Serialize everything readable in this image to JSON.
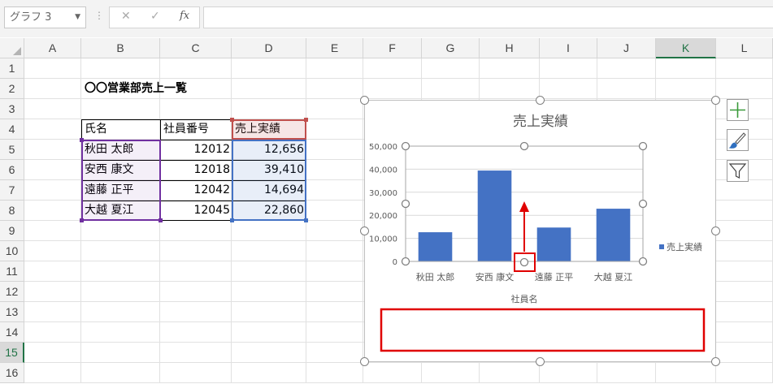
{
  "formula_bar": {
    "name_box": "グラフ 3",
    "cancel_glyph": "✕",
    "enter_glyph": "✓",
    "fx_glyph": "fx",
    "formula_value": ""
  },
  "columns": [
    "A",
    "B",
    "C",
    "D",
    "E",
    "F",
    "G",
    "H",
    "I",
    "J",
    "K",
    "L"
  ],
  "rows": [
    "1",
    "2",
    "3",
    "4",
    "5",
    "6",
    "7",
    "8",
    "9",
    "10",
    "11",
    "12",
    "13",
    "14",
    "15",
    "16"
  ],
  "sheet": {
    "title": "〇〇営業部売上一覧",
    "headers": [
      "氏名",
      "社員番号",
      "売上実績"
    ],
    "data": [
      [
        "秋田 太郎",
        "12012",
        "12,656"
      ],
      [
        "安西 康文",
        "12018",
        "39,410"
      ],
      [
        "遠藤 正平",
        "12042",
        "14,694"
      ],
      [
        "大越 夏江",
        "12045",
        "22,860"
      ]
    ]
  },
  "chart_data": {
    "type": "bar",
    "title": "売上実績",
    "xlabel": "社員名",
    "ylabel": "",
    "categories": [
      "秋田 太郎",
      "安西 康文",
      "遠藤 正平",
      "大越 夏江"
    ],
    "series": [
      {
        "name": "売上実績",
        "values": [
          12656,
          39410,
          14694,
          22860
        ],
        "color": "#4472c4"
      }
    ],
    "ylim": [
      0,
      50000
    ],
    "yticks": [
      "0",
      "10,000",
      "20,000",
      "30,000",
      "40,000",
      "50,000"
    ],
    "grid": true,
    "legend": "right"
  },
  "side_buttons": [
    "chart-elements-icon",
    "chart-styles-icon",
    "chart-filters-icon"
  ],
  "colors": {
    "accent": "#217346",
    "bar": "#4472c4",
    "annotation": "#e00000",
    "range_name": "#7030a0",
    "range_label": "#c0504d",
    "range_values": "#4472c4"
  }
}
